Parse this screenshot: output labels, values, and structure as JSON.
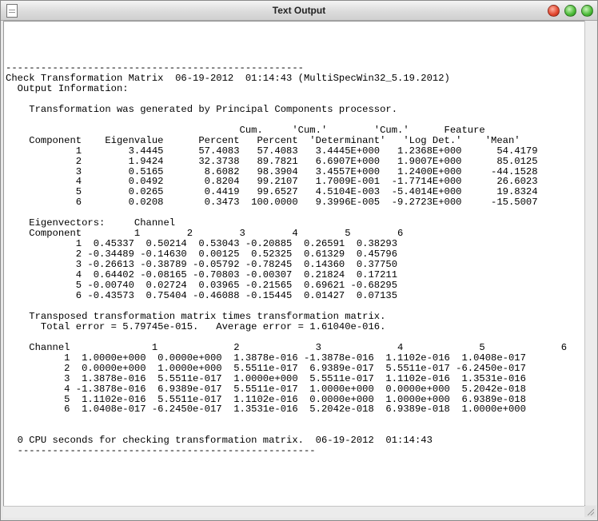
{
  "window": {
    "title": "Text Output",
    "icons": {
      "document": "document-icon",
      "close": "close-button",
      "minimize": "minimize-button",
      "maximize": "maximize-button"
    },
    "colors": {
      "close": "#e0442c",
      "minimize": "#48b834",
      "maximize": "#48b834"
    }
  },
  "output": {
    "rule_top": "---------------------------------------------------",
    "heading": "Check Transformation Matrix  06-19-2012  01:14:43 (MultiSpecWin32_5.19.2012)",
    "info_label": "  Output Information:",
    "generated_by": "    Transformation was generated by Principal Components processor.",
    "components": {
      "header1": "                                        Cum.     'Cum.'        'Cum.'      Feature",
      "header2": "    Component    Eigenvalue      Percent   Percent  'Determinant'   'Log Det.'    'Mean'",
      "rows": [
        "            1        3.4445      57.4083   57.4083   3.4445E+000   1.2368E+000      54.4179",
        "            2        1.9424      32.3738   89.7821   6.6907E+000   1.9007E+000      85.0125",
        "            3        0.5165       8.6082   98.3904   3.4557E+000   1.2400E+000     -44.1528",
        "            4        0.0492       0.8204   99.2107   1.7009E-001  -1.7714E+000      26.6023",
        "            5        0.0265       0.4419   99.6527   4.5104E-003  -5.4014E+000      19.8324",
        "            6        0.0208       0.3473  100.0000   9.3996E-005  -9.2723E+000     -15.5007"
      ]
    },
    "eigenvectors": {
      "header1": "    Eigenvectors:     Channel",
      "header2": "    Component         1        2        3        4        5        6",
      "rows": [
        "            1  0.45337  0.50214  0.53043 -0.20885  0.26591  0.38293",
        "            2 -0.34489 -0.14630  0.00125  0.52325  0.61329  0.45796",
        "            3 -0.26613 -0.38789 -0.05792 -0.78245  0.14360  0.37750",
        "            4  0.64402 -0.08165 -0.70803 -0.00307  0.21824  0.17211",
        "            5 -0.00740  0.02724  0.03965 -0.21565  0.69621 -0.68295",
        "            6 -0.43573  0.75404 -0.46088 -0.15445  0.01427  0.07135"
      ]
    },
    "transposed": {
      "line1": "    Transposed transformation matrix times transformation matrix.",
      "line2": "      Total error = 5.79745e-015.   Average error = 1.61040e-016."
    },
    "channel_matrix": {
      "header": "    Channel              1             2             3             4             5             6",
      "rows": [
        "          1  1.0000e+000  0.0000e+000  1.3878e-016 -1.3878e-016  1.1102e-016  1.0408e-017",
        "          2  0.0000e+000  1.0000e+000  5.5511e-017  6.9389e-017  5.5511e-017 -6.2450e-017",
        "          3  1.3878e-016  5.5511e-017  1.0000e+000  5.5511e-017  1.1102e-016  1.3531e-016",
        "          4 -1.3878e-016  6.9389e-017  5.5511e-017  1.0000e+000  0.0000e+000  5.2042e-018",
        "          5  1.1102e-016  5.5511e-017  1.1102e-016  0.0000e+000  1.0000e+000  6.9389e-018",
        "          6  1.0408e-017 -6.2450e-017  1.3531e-016  5.2042e-018  6.9389e-018  1.0000e+000"
      ]
    },
    "cpu_line": "  0 CPU seconds for checking transformation matrix.  06-19-2012  01:14:43",
    "rule_bottom": "  ---------------------------------------------------"
  }
}
